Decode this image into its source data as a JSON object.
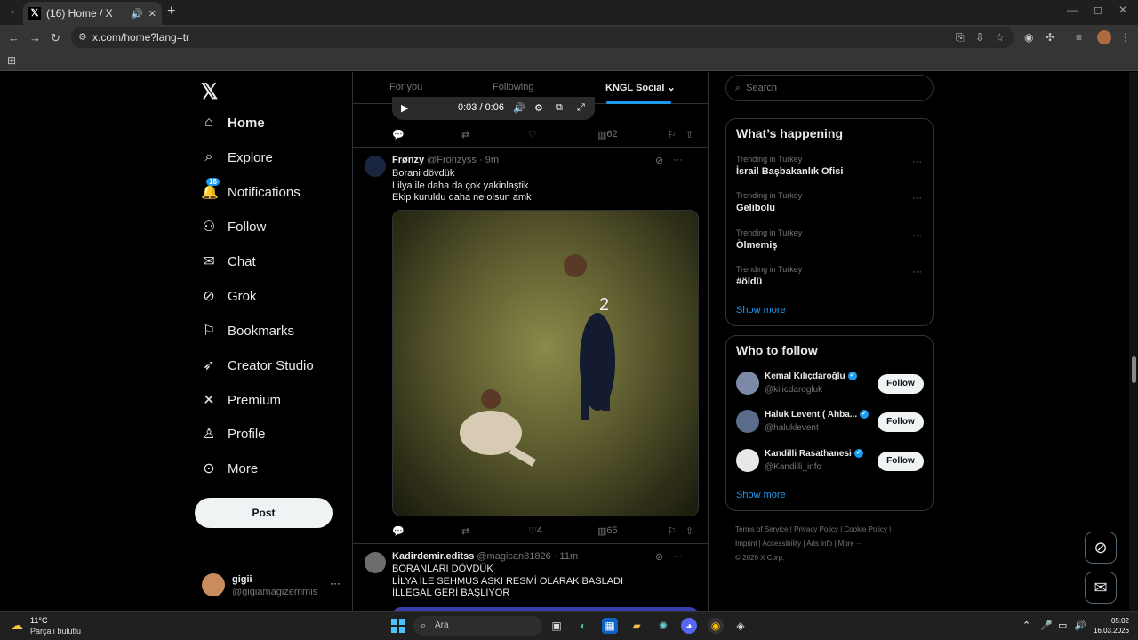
{
  "browser": {
    "tab_title": "(16) Home / X",
    "url": "x.com/home?lang=tr",
    "favicon_glyph": "𝕏"
  },
  "leftnav": {
    "logo": "𝕏",
    "items": [
      {
        "label": "Home",
        "icon": "home-icon",
        "glyph": "⌂"
      },
      {
        "label": "Explore",
        "icon": "search-icon",
        "glyph": "⌕"
      },
      {
        "label": "Notifications",
        "icon": "bell-icon",
        "glyph": "🔔",
        "badge": "16"
      },
      {
        "label": "Follow",
        "icon": "person-plus-icon",
        "glyph": "⚇"
      },
      {
        "label": "Chat",
        "icon": "mail-icon",
        "glyph": "✉"
      },
      {
        "label": "Grok",
        "icon": "grok-icon",
        "glyph": "⊘"
      },
      {
        "label": "Bookmarks",
        "icon": "bookmark-icon",
        "glyph": "⚐"
      },
      {
        "label": "Creator Studio",
        "icon": "rocket-icon",
        "glyph": "➶"
      },
      {
        "label": "Premium",
        "icon": "x-icon",
        "glyph": "✕"
      },
      {
        "label": "Profile",
        "icon": "person-icon",
        "glyph": "♙"
      },
      {
        "label": "More",
        "icon": "more-circle-icon",
        "glyph": "⊙"
      }
    ],
    "post_label": "Post",
    "account": {
      "name": "gigii",
      "handle": "@gigiamagizemmis"
    }
  },
  "feed": {
    "tabs": [
      "For you",
      "Following",
      "KNGL Social"
    ],
    "video": {
      "time": "0:03 / 0:06"
    },
    "top_actions": {
      "views": "62"
    },
    "tweets": [
      {
        "display_name": "Frønzy",
        "handle": "@Fronzyss",
        "time": "9m",
        "lines": [
          "Borani dövdük",
          "Lilya ile daha da çok yakinlaştik",
          "Ekip kuruldu daha ne olsun amk"
        ],
        "likes": "4",
        "views": "65"
      },
      {
        "display_name": "Kadirdemir.editss",
        "handle": "@magican81826",
        "time": "11m",
        "lines": [
          "BORANLARI DÖVDÜK",
          "LİLYA İLE SEHMUS ASKI RESMİ OLARAK BASLADI",
          "İLLEGAL GERİ BAŞLIYOR"
        ]
      }
    ]
  },
  "right": {
    "search_placeholder": "Search",
    "happening_title": "What’s happening",
    "trends": [
      {
        "category": "Trending in Turkey",
        "name": "İsrail Başbakanlık Ofisi"
      },
      {
        "category": "Trending in Turkey",
        "name": "Gelibolu"
      },
      {
        "category": "Trending in Turkey",
        "name": "Ölmemiş"
      },
      {
        "category": "Trending in Turkey",
        "name": "#öldü"
      }
    ],
    "show_more": "Show more",
    "wtf_title": "Who to follow",
    "who_to_follow": [
      {
        "name": "Kemal Kılıçdaroğlu",
        "handle": "@kilicdarogluk",
        "button": "Follow"
      },
      {
        "name": "Haluk Levent ( Ahba...",
        "handle": "@haluklevent",
        "button": "Follow"
      },
      {
        "name": "Kandilli Rasathanesi",
        "handle": "@Kandilli_info",
        "button": "Follow"
      }
    ],
    "footer": [
      "Terms of Service",
      "Privacy Policy",
      "Cookie Policy",
      "Imprint",
      "Accessibility",
      "Ads info",
      "More ···",
      "© 2026 X Corp."
    ]
  },
  "taskbar": {
    "temp": "11°C",
    "weather": "Parçalı bulutlu",
    "search_placeholder": "Ara",
    "time": "05:02",
    "date": "16.03.2026"
  }
}
